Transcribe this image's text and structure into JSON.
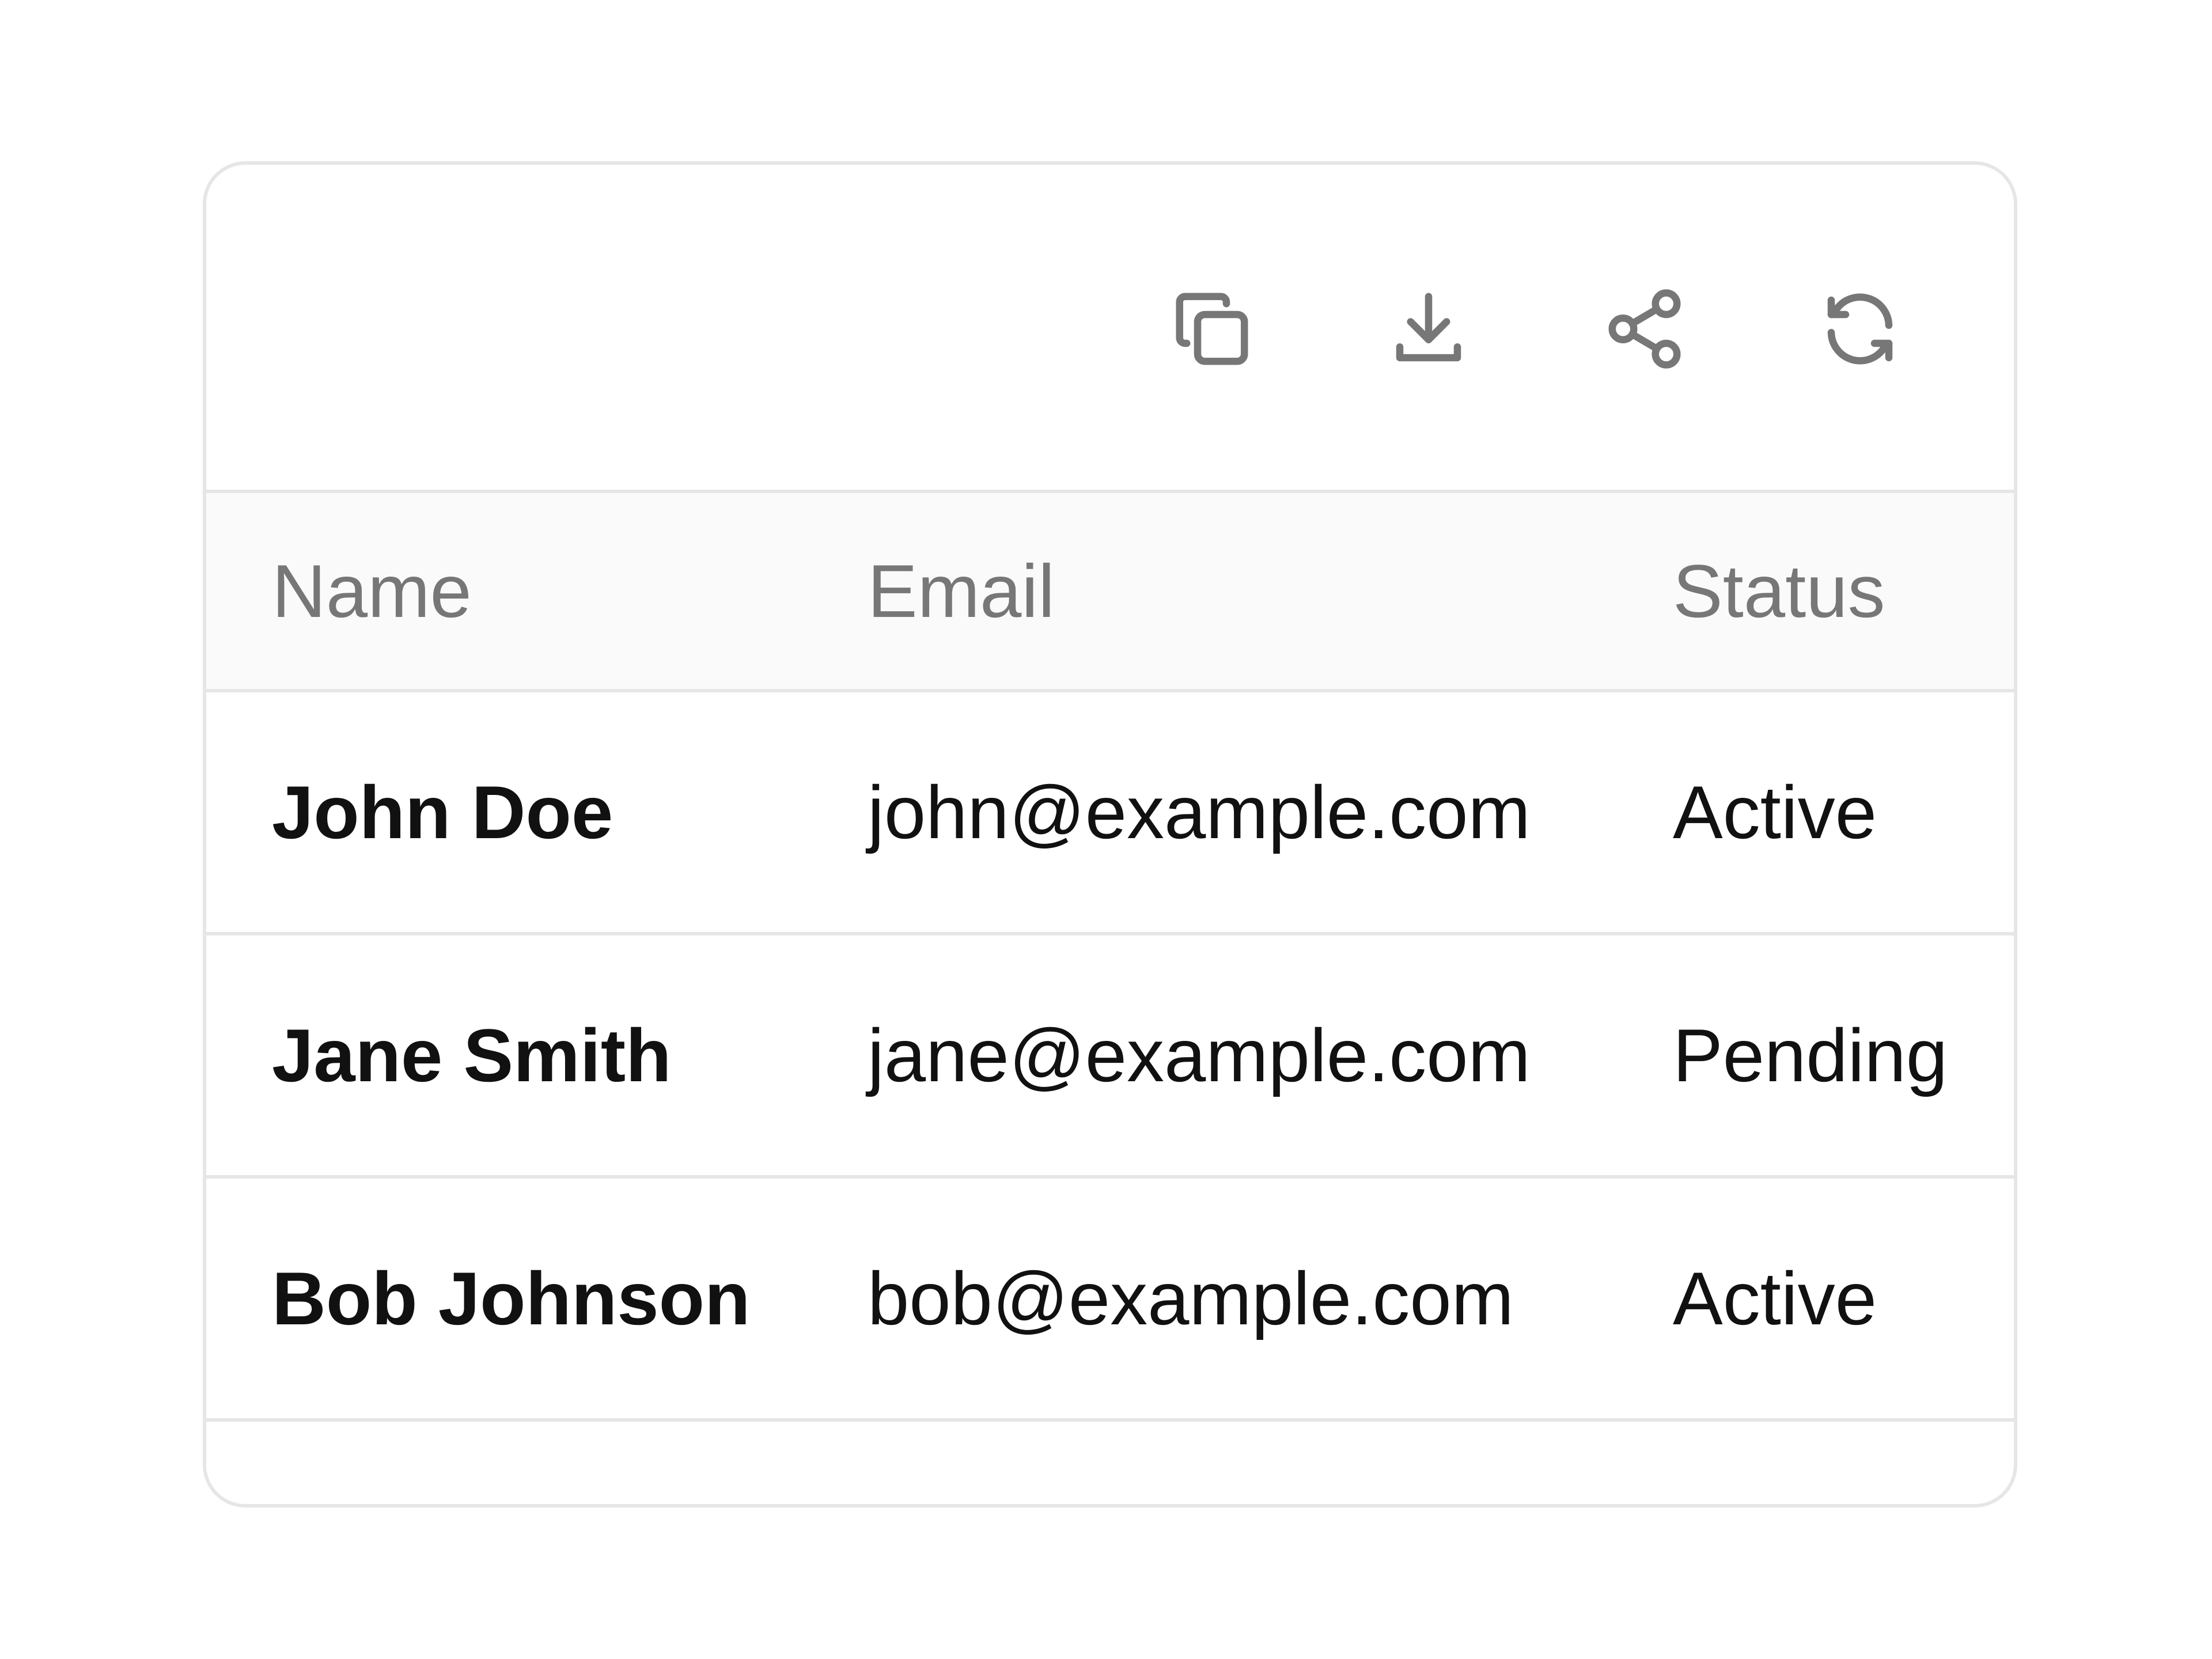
{
  "toolbar": {
    "actions": [
      {
        "name": "copy",
        "icon": "copy-icon"
      },
      {
        "name": "download",
        "icon": "download-icon"
      },
      {
        "name": "share",
        "icon": "share-icon"
      },
      {
        "name": "refresh",
        "icon": "refresh-icon"
      }
    ]
  },
  "table": {
    "columns": [
      "Name",
      "Email",
      "Status"
    ],
    "rows": [
      {
        "name": "John Doe",
        "email": "john@example.com",
        "status": "Active"
      },
      {
        "name": "Jane Smith",
        "email": "jane@example.com",
        "status": "Pending"
      },
      {
        "name": "Bob Johnson",
        "email": "bob@example.com",
        "status": "Active"
      }
    ]
  },
  "colors": {
    "border": "#e6e6e6",
    "header_bg": "#fafafa",
    "icon": "#777777",
    "header_text": "#777777",
    "cell_text": "#111111"
  }
}
